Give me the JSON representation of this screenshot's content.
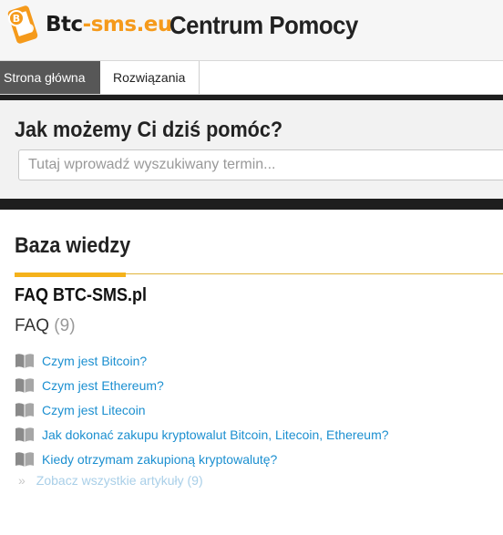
{
  "header": {
    "logo_name": "Btc",
    "logo_accent": "-sms.eu",
    "title": "Centrum Pomocy",
    "logo_icon": "bitcoin-phone-icon"
  },
  "nav": {
    "tabs": [
      {
        "label": "Strona główna",
        "active": true
      },
      {
        "label": "Rozwiązania",
        "active": false
      }
    ]
  },
  "search": {
    "title": "Jak możemy Ci dziś pomóc?",
    "placeholder": "Tutaj wprowadź wyszukiwany termin..."
  },
  "knowledge_base": {
    "title": "Baza wiedzy",
    "category_title": "FAQ BTC-SMS.pl",
    "folder": {
      "name": "FAQ",
      "count": "(9)"
    },
    "articles": [
      {
        "title": "Czym jest Bitcoin?",
        "icon": "book-icon"
      },
      {
        "title": "Czym jest Ethereum?",
        "icon": "book-icon"
      },
      {
        "title": "Czym jest Litecoin",
        "icon": "book-icon"
      },
      {
        "title": "Jak dokonać zakupu kryptowalut Bitcoin, Litecoin, Ethereum?",
        "icon": "book-icon"
      },
      {
        "title": "Kiedy otrzymam zakupioną kryptowalutę?",
        "icon": "book-icon"
      }
    ],
    "see_all": "Zobacz wszystkie artykuły (9)"
  },
  "colors": {
    "accent": "#f5b21b",
    "link": "#1b8fd0",
    "dark_bar": "#1e1e1e",
    "active_tab": "#575757"
  }
}
